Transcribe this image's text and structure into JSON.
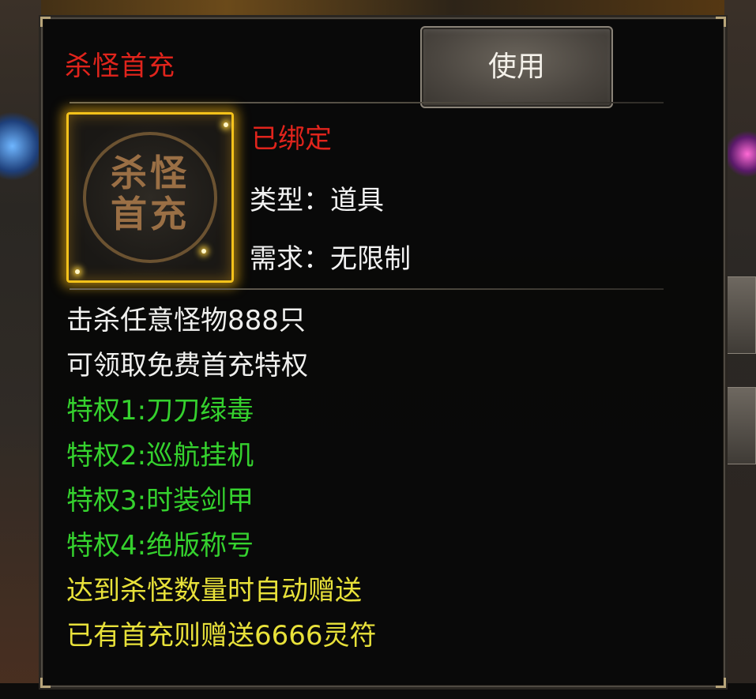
{
  "tooltip": {
    "item_name": "杀怪首充",
    "use_button": "使用",
    "icon": {
      "name": "kill-monster-first-charge-icon",
      "glyph_line1": "杀怪",
      "glyph_line2": "首充"
    },
    "bound_status": "已绑定",
    "type_line": "类型：道具",
    "requirement_line": "需求：无限制",
    "description": {
      "line1": "击杀任意怪物888只",
      "line2": "可领取免费首充特权",
      "privilege1": "特权1:刀刀绿毒",
      "privilege2": "特权2:巡航挂机",
      "privilege3": "特权3:时装剑甲",
      "privilege4": "特权4:绝版称号",
      "note1": "达到杀怪数量时自动赠送",
      "note2": "已有首充则赠送6666灵符"
    }
  },
  "colors": {
    "item_name": "#e0241c",
    "bound_status": "#e0241c",
    "normal_text": "#f0f0ee",
    "privilege_text": "#35d12e",
    "note_text": "#e8e13a",
    "icon_border": "#f5c21a"
  }
}
